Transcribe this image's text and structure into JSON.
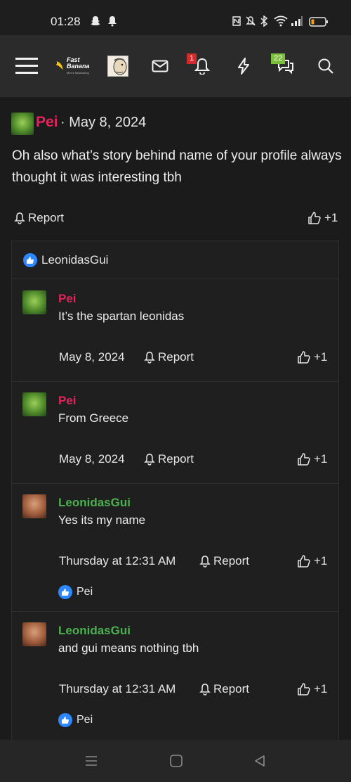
{
  "status": {
    "time": "01:28"
  },
  "nav": {
    "notif_count": "1",
    "chat_count": "22",
    "logo_text": "Fast Banana",
    "logo_sub": "Men's Networking"
  },
  "post": {
    "user": "Pei",
    "date": "May 8, 2024",
    "body": "Oh also what’s story behind name of your profile always thought it was interesting tbh",
    "report": "Report",
    "like": "+1"
  },
  "likes_head": {
    "user": "LeonidasGui"
  },
  "replies": [
    {
      "user": "Pei",
      "text": "It’s the spartan leonidas",
      "date": "May 8, 2024",
      "report": "Report",
      "like": "+1"
    },
    {
      "user": "Pei",
      "text": "From Greece",
      "date": "May 8, 2024",
      "report": "Report",
      "like": "+1"
    },
    {
      "user": "LeonidasGui",
      "text": "Yes its my name",
      "date": "Thursday at 12:31 AM",
      "report": "Report",
      "like": "+1",
      "liked_by": "Pei"
    },
    {
      "user": "LeonidasGui",
      "text": "and gui means nothing tbh",
      "date": "Thursday at 12:31 AM",
      "report": "Report",
      "like": "+1",
      "liked_by": "Pei"
    }
  ]
}
